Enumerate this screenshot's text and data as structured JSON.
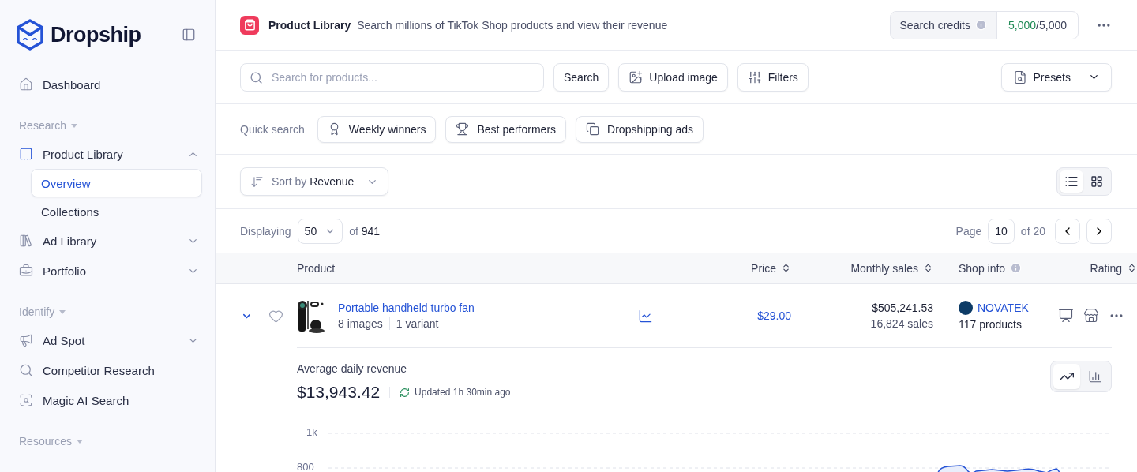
{
  "sidebar": {
    "logo": "Dropship",
    "nav": [
      {
        "kind": "item",
        "label": "Dashboard"
      },
      {
        "kind": "section",
        "label": "Research"
      },
      {
        "kind": "item",
        "label": "Product Library",
        "expanded": true,
        "children": [
          {
            "label": "Overview",
            "selected": true
          },
          {
            "label": "Collections",
            "selected": false
          }
        ]
      },
      {
        "kind": "item",
        "label": "Ad Library",
        "expanded": false
      },
      {
        "kind": "item",
        "label": "Portfolio",
        "expanded": false
      },
      {
        "kind": "section",
        "label": "Identify"
      },
      {
        "kind": "item",
        "label": "Ad Spot",
        "expanded": false
      },
      {
        "kind": "item",
        "label": "Competitor Research"
      },
      {
        "kind": "item",
        "label": "Magic AI Search"
      },
      {
        "kind": "section",
        "label": "Resources"
      }
    ]
  },
  "header": {
    "title": "Product Library",
    "subtitle": "Search millions of TikTok Shop products and view their revenue",
    "credits": {
      "label": "Search credits",
      "used": "5,000",
      "total": "/5,000"
    }
  },
  "toolbar": {
    "search": {
      "placeholder": "Search for products..."
    },
    "buttons": [
      {
        "kind": "plain",
        "label": "Search"
      },
      {
        "kind": "upload",
        "label": "Upload image"
      },
      {
        "kind": "filters",
        "label": "Filters"
      }
    ],
    "presets": "Presets"
  },
  "quick_search": {
    "label": "Quick search",
    "chips": [
      {
        "label": "Weekly winners"
      },
      {
        "label": "Best performers"
      },
      {
        "label": "Dropshipping ads"
      }
    ]
  },
  "sort": {
    "prefix": "Sort by",
    "value": "Revenue"
  },
  "view_toggle": [
    {
      "kind": "list",
      "selected": true
    },
    {
      "kind": "grid",
      "selected": false
    }
  ],
  "paging": {
    "displaying_label": "Displaying",
    "page_size": "50",
    "of_label": "of",
    "total": "941",
    "page_label": "Page",
    "page": "10",
    "pages": "of 20"
  },
  "table": {
    "columns": [
      {
        "label": "Product",
        "sortable": false,
        "info": false
      },
      {
        "label": "Price",
        "sortable": true,
        "info": false
      },
      {
        "label": "Monthly sales",
        "sortable": true,
        "info": false
      },
      {
        "label": "Shop info",
        "sortable": false,
        "info": true
      },
      {
        "label": "Rating",
        "sortable": true,
        "info": false
      }
    ],
    "rows": [
      {
        "expanded": true,
        "favorite": false,
        "name": "Portable handheld turbo fan",
        "images": "8 images",
        "variants": "1 variant",
        "price": "$29.00",
        "revenue": "$505,241.53",
        "sales": "16,824 sales",
        "shop": "NOVATEK",
        "shop_products": "117 products",
        "details": {
          "label": "Average daily revenue",
          "value": "$13,943.42",
          "updated": "Updated 1h 30min ago",
          "chart_modes": [
            {
              "kind": "line",
              "selected": true
            },
            {
              "kind": "bar",
              "selected": false
            }
          ],
          "tick_labels": [
            "1k",
            "800"
          ]
        }
      }
    ]
  }
}
